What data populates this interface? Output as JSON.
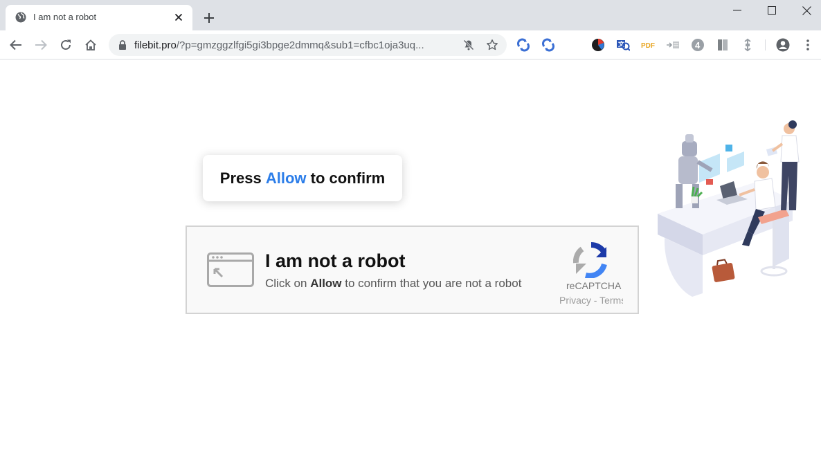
{
  "browser": {
    "tab": {
      "title": "I am not a robot"
    },
    "url": {
      "host": "filebit.pro",
      "rest": "/?p=gmzggzlfgi5gi3bpge2dmmq&sub1=cfbc1oja3uq..."
    }
  },
  "page": {
    "press": {
      "before": "Press",
      "allow": "Allow",
      "after": "to confirm"
    },
    "captcha": {
      "title": "I am not a robot",
      "sub_before": "Click on",
      "sub_allow": "Allow",
      "sub_after": "to confirm that you are not a robot",
      "brand": "reCAPTCHA",
      "links": "Privacy - Terms"
    }
  },
  "colors": {
    "accent": "#2b7de9",
    "tabstrip": "#dee1e6",
    "omnibox": "#f1f3f4"
  },
  "icons": [
    "globe-icon",
    "close-icon",
    "plus-icon",
    "minimize-icon",
    "maximize-icon",
    "back-icon",
    "forward-icon",
    "reload-icon",
    "home-icon",
    "lock-icon",
    "bell-off-icon",
    "star-icon",
    "sync-icon",
    "pdf-icon",
    "profile-icon",
    "menu-icon",
    "recaptcha-icon",
    "browser-window-icon"
  ]
}
